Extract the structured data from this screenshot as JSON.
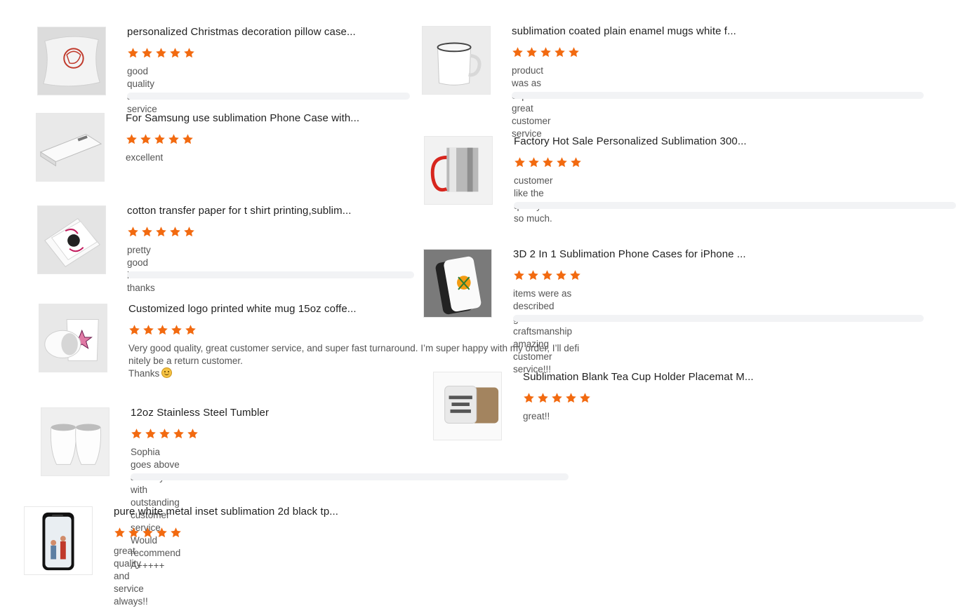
{
  "star_color": "#f26a10",
  "reviews": [
    {
      "title": "personalized Christmas decoration pillow case...",
      "rating": 5,
      "comment": "good quality and service",
      "image_icon": "pillow-icon"
    },
    {
      "title": "sublimation coated plain enamel mugs white f...",
      "rating": 5,
      "comment": "product was as expected. great customer service",
      "image_icon": "enamel-mug-icon"
    },
    {
      "title": "For Samsung use sublimation Phone Case with...",
      "rating": 5,
      "comment": "excellent",
      "image_icon": "phone-case-icon"
    },
    {
      "title": "Factory Hot Sale Personalized Sublimation 300...",
      "rating": 5,
      "comment": "customer like the quality so much.",
      "image_icon": "steel-mug-icon"
    },
    {
      "title": "cotton transfer paper for t shirt printing,sublim...",
      "rating": 5,
      "comment": "pretty good item thanks",
      "image_icon": "transfer-paper-icon"
    },
    {
      "title": "3D 2 In 1 Sublimation Phone Cases for iPhone ...",
      "rating": 5,
      "comment": "items were as described great craftsmanship amazing customer service!!!",
      "image_icon": "iphone-case-icon"
    },
    {
      "title": "Customized logo printed white mug 15oz coffe...",
      "rating": 5,
      "comment_line1": "Very good quality, great customer service, and super fast turnaround. I’m super happy with my order, I’ll defi",
      "comment_line2": "nitely be a return customer.",
      "comment_line3": "Thanks",
      "image_icon": "white-mug-icon"
    },
    {
      "title": "Sublimation Blank Tea Cup Holder Placemat M...",
      "rating": 5,
      "comment": "great!!",
      "image_icon": "coaster-icon"
    },
    {
      "title": "12oz Stainless Steel Tumbler",
      "rating": 5,
      "comment": "Sophia goes above and beyond with outstanding customer service. Would recommend A+++++",
      "image_icon": "tumbler-icon"
    },
    {
      "title": "pure white metal inset sublimation 2d black tp...",
      "rating": 5,
      "comment": "great quality and service always!!",
      "image_icon": "phone-case-black-icon"
    }
  ]
}
